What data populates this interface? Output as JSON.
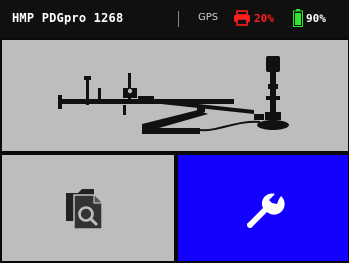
{
  "status_bar": {
    "device_title": "HMP PDGpro 1268",
    "gps_label": "GPS",
    "printer_level": "20%",
    "battery_level": "90%",
    "printer_level_color": "#ff1e1e",
    "battery_color": "#2ee62e"
  },
  "tiles": {
    "device": {
      "icon": "pdg-apparatus-illustration"
    },
    "files": {
      "icon": "file-search-icon"
    },
    "settings": {
      "icon": "wrench-icon",
      "color": "#1400ff"
    }
  },
  "colors": {
    "status_bar_bg": "#101010",
    "tile_gray": "#bdbdbd",
    "tile_blue": "#1400ff"
  }
}
